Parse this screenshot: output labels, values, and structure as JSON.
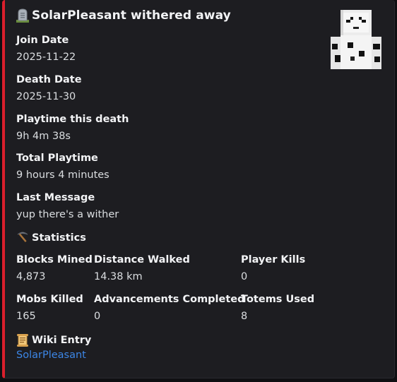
{
  "embed": {
    "title": "SolarPleasant withered away",
    "accent_color": "#da1f2c",
    "title_icon": "headstone-icon",
    "thumbnail": "player-skin-avatar"
  },
  "fields": {
    "join_date": {
      "name": "Join Date",
      "value": "2025-11-22"
    },
    "death_date": {
      "name": "Death Date",
      "value": "2025-11-30"
    },
    "playtime_death": {
      "name": "Playtime this death",
      "value": "9h 4m 38s"
    },
    "total_playtime": {
      "name": "Total Playtime",
      "value": "9 hours 4 minutes"
    },
    "last_message": {
      "name": "Last Message",
      "value": "yup there's a wither"
    }
  },
  "statistics": {
    "heading": "Statistics",
    "icon": "pickaxe-icon",
    "blocks_mined": {
      "name": "Blocks Mined",
      "value": "4,873"
    },
    "distance_walked": {
      "name": "Distance Walked",
      "value": "14.38 km"
    },
    "player_kills": {
      "name": "Player Kills",
      "value": "0"
    },
    "mobs_killed": {
      "name": "Mobs Killed",
      "value": "165"
    },
    "advancements": {
      "name": "Advancements Completed",
      "value": "0"
    },
    "totems_used": {
      "name": "Totems Used",
      "value": "8"
    }
  },
  "wiki": {
    "heading": "Wiki Entry",
    "icon": "scroll-icon",
    "link_text": "SolarPleasant"
  }
}
